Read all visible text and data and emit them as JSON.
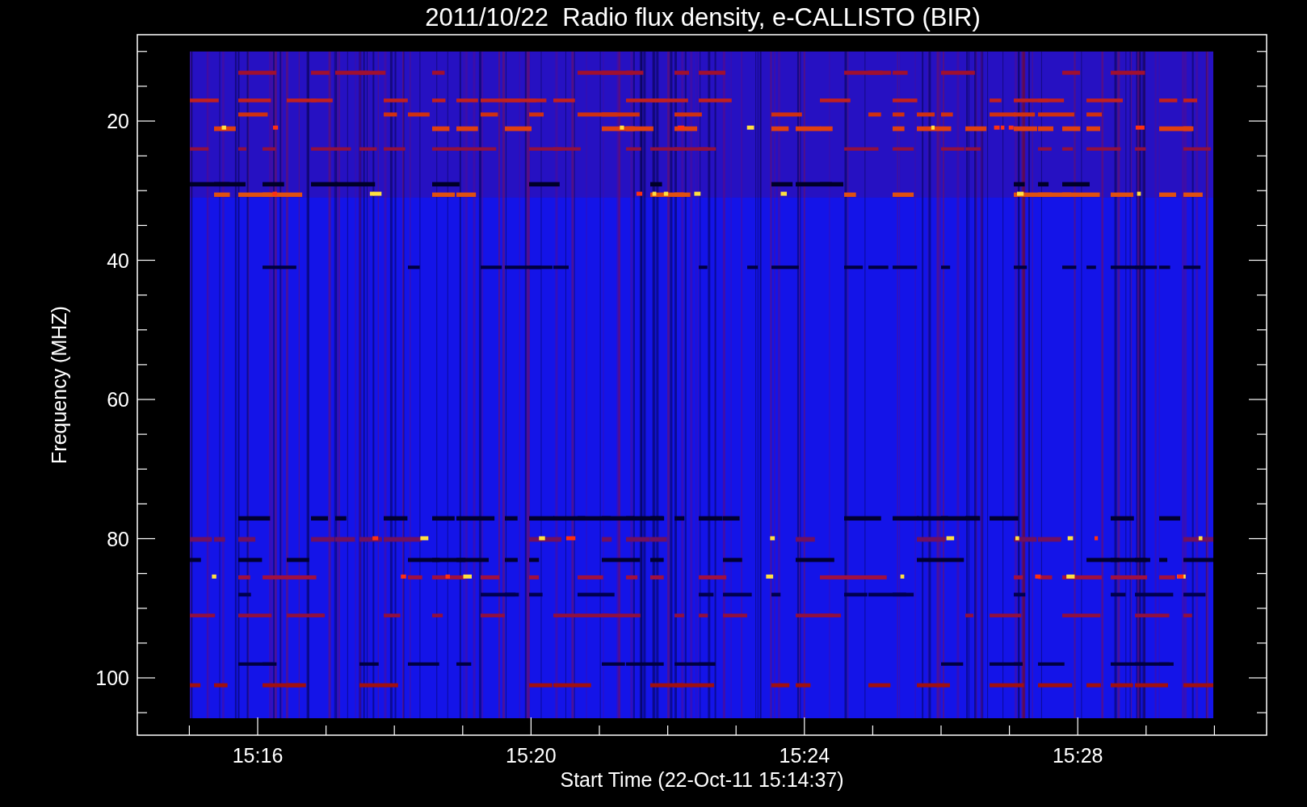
{
  "title": "2011/10/22  Radio flux density, e-CALLISTO (BIR)",
  "y_axis": {
    "label": "Frequency (MHZ)",
    "ticks": [
      "20",
      "40",
      "60",
      "80",
      "100"
    ]
  },
  "x_axis": {
    "label": "Start Time (22-Oct-11 15:14:37)",
    "ticks": [
      "15:16",
      "15:20",
      "15:24",
      "15:28"
    ]
  }
}
